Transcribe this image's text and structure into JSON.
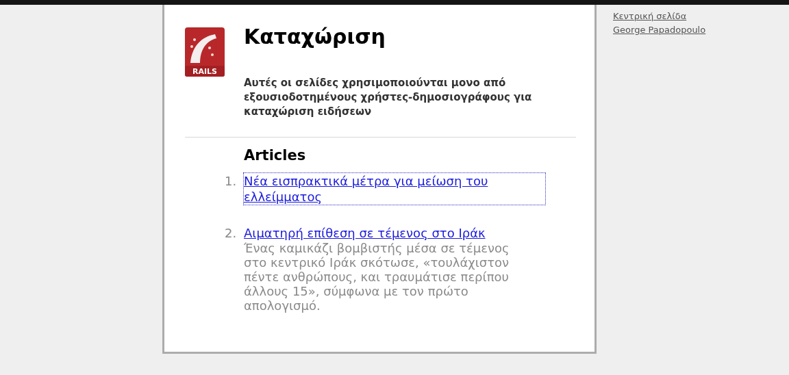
{
  "page": {
    "logo_text": "RAILS",
    "title": "Καταχώριση",
    "intro": "Αυτές οι σελίδες χρησιμοποιούνται μονο από εξουσιοδοτημένους χρήστες-δημοσιογράφους για καταχώριση ειδήσεων"
  },
  "articles": {
    "heading": "Articles",
    "items": [
      {
        "number": "1.",
        "title": "Νέα εισπρακτικά μέτρα για μείωση του ελλείμματος",
        "focused": true
      },
      {
        "number": "2.",
        "title": "Αιματηρή επίθεση σε τέμενος στο Ιράκ",
        "focused": false,
        "summary": "Ένας καμικάζι βομβιστής μέσα σε τέμενος στο κεντρικό Ιράκ σκότωσε, «τουλάχιστον πέντε ανθρώπους, και τραυμάτισε περίπου άλλους 15», σύμφωνα με τον πρώτο απολογισμό."
      }
    ]
  },
  "sidebar": {
    "links": [
      "Κεντρική σελίδα",
      "George Papadopoulo"
    ]
  }
}
